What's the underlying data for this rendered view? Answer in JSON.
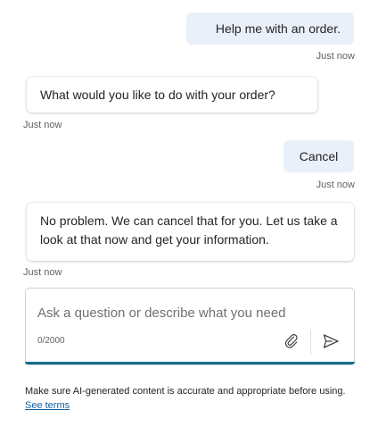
{
  "conversation": {
    "messages": [
      {
        "role": "user",
        "text": "Help me with an order.",
        "timestamp": "Just now"
      },
      {
        "role": "bot",
        "text": "What would you like to do with your order?",
        "timestamp": "Just now"
      },
      {
        "role": "user",
        "text": "Cancel",
        "timestamp": "Just now"
      },
      {
        "role": "bot",
        "text": "No problem. We can cancel that for you. Let us take a look at that now and get your information.",
        "timestamp": "Just now"
      }
    ]
  },
  "composer": {
    "placeholder": "Ask a question or describe what you need",
    "value": "",
    "counter": "0/2000",
    "attach_icon": "paperclip-icon",
    "send_icon": "send-icon",
    "accent_color": "#0f6f8a"
  },
  "disclaimer": {
    "text": "Make sure AI-generated content is accurate and appropriate before using.",
    "link_text": "See terms"
  }
}
